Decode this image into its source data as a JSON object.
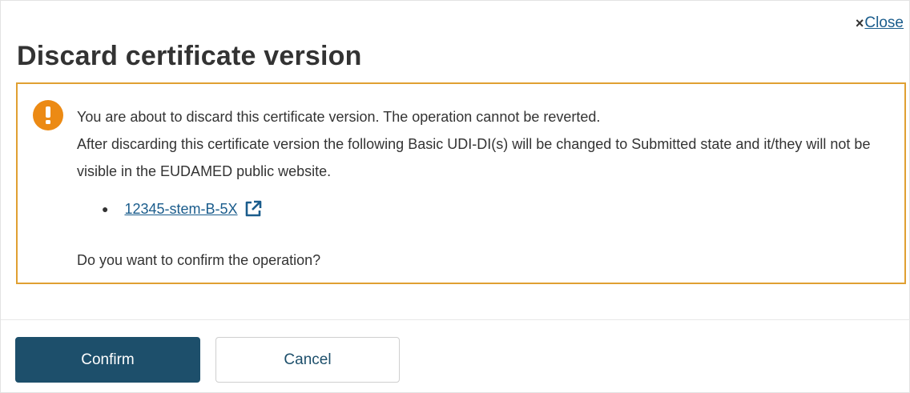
{
  "dialog": {
    "close_label": "Close",
    "close_icon": "×",
    "title": "Discard certificate version"
  },
  "alert": {
    "icon": "exclamation-circle-icon",
    "line1": "You are about to discard this certificate version. The operation cannot be reverted.",
    "line2": "After discarding this certificate version the following Basic UDI-DI(s) will be changed to Submitted state and it/they will not be visible in the EUDAMED public website.",
    "udi_items": [
      {
        "label": "12345-stem-B-5X",
        "icon": "external-link-icon"
      }
    ],
    "question": "Do you want to confirm the operation?"
  },
  "footer": {
    "confirm_label": "Confirm",
    "cancel_label": "Cancel"
  },
  "colors": {
    "accent": "#1d4f6b",
    "link": "#1a5c8c",
    "warning_border": "#e0a032",
    "warning_icon": "#ec8a14"
  }
}
